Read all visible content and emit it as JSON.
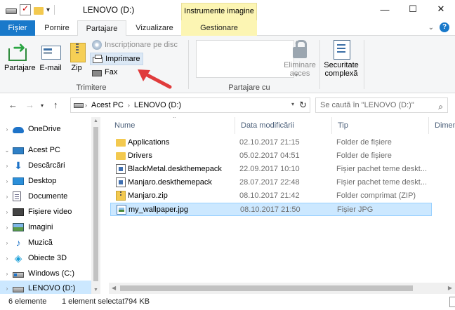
{
  "window": {
    "title": "LENOVO (D:)",
    "context_title": "Instrumente imagine"
  },
  "tabs": {
    "file": "Fișier",
    "home": "Pornire",
    "share": "Partajare",
    "view": "Vizualizare",
    "manage": "Gestionare"
  },
  "ribbon": {
    "share": "Partajare",
    "email": "E-mail",
    "zip": "Zip",
    "burn": "Inscripționare pe disc",
    "print": "Imprimare",
    "fax": "Fax",
    "send_group": "Trimitere",
    "remove_access": "Eliminare acces",
    "advanced_security": "Securitate complexă",
    "share_with_group": "Partajare cu"
  },
  "address": {
    "segments": [
      "Acest PC",
      "LENOVO (D:)"
    ],
    "search_placeholder": "Se caută în \"LENOVO (D:)\""
  },
  "nav": {
    "items": [
      {
        "label": "OneDrive",
        "icon": "onedrive-icon"
      },
      {
        "label": "Acest PC",
        "icon": "this-pc-icon"
      },
      {
        "label": "Descărcări",
        "icon": "downloads-icon"
      },
      {
        "label": "Desktop",
        "icon": "desktop-icon"
      },
      {
        "label": "Documente",
        "icon": "documents-icon"
      },
      {
        "label": "Fișiere video",
        "icon": "videos-icon"
      },
      {
        "label": "Imagini",
        "icon": "pictures-icon"
      },
      {
        "label": "Muzică",
        "icon": "music-icon"
      },
      {
        "label": "Obiecte 3D",
        "icon": "3d-objects-icon"
      },
      {
        "label": "Windows (C:)",
        "icon": "windows-drive-icon"
      },
      {
        "label": "LENOVO (D:)",
        "icon": "drive-icon",
        "selected": true
      }
    ]
  },
  "columns": {
    "name": "Nume",
    "date": "Data modificării",
    "type": "Tip",
    "size": "Dimensiune"
  },
  "files": [
    {
      "name": "Applications",
      "date": "02.10.2017 21:15",
      "type": "Folder de fișiere",
      "icon": "folder-icon"
    },
    {
      "name": "Drivers",
      "date": "05.02.2017 04:51",
      "type": "Folder de fișiere",
      "icon": "folder-icon"
    },
    {
      "name": "BlackMetal.deskthemepack",
      "date": "22.09.2017 10:10",
      "type": "Fișier pachet teme deskt...",
      "icon": "themepack-icon"
    },
    {
      "name": "Manjaro.deskthemepack",
      "date": "28.07.2017 22:48",
      "type": "Fișier pachet teme deskt...",
      "icon": "themepack-icon"
    },
    {
      "name": "Manjaro.zip",
      "date": "08.10.2017 21:42",
      "type": "Folder comprimat (ZIP)",
      "icon": "zip-icon"
    },
    {
      "name": "my_wallpaper.jpg",
      "date": "08.10.2017 21:50",
      "type": "Fișier JPG",
      "icon": "jpg-icon",
      "selected": true
    }
  ],
  "status": {
    "count": "6 elemente",
    "selection": "1 element selectat",
    "size": "794 KB"
  },
  "colors": {
    "file_tab": "#1979ca",
    "context_tab": "#fcf5b3",
    "selection": "#cce8ff",
    "arrow": "#e03c3c"
  }
}
